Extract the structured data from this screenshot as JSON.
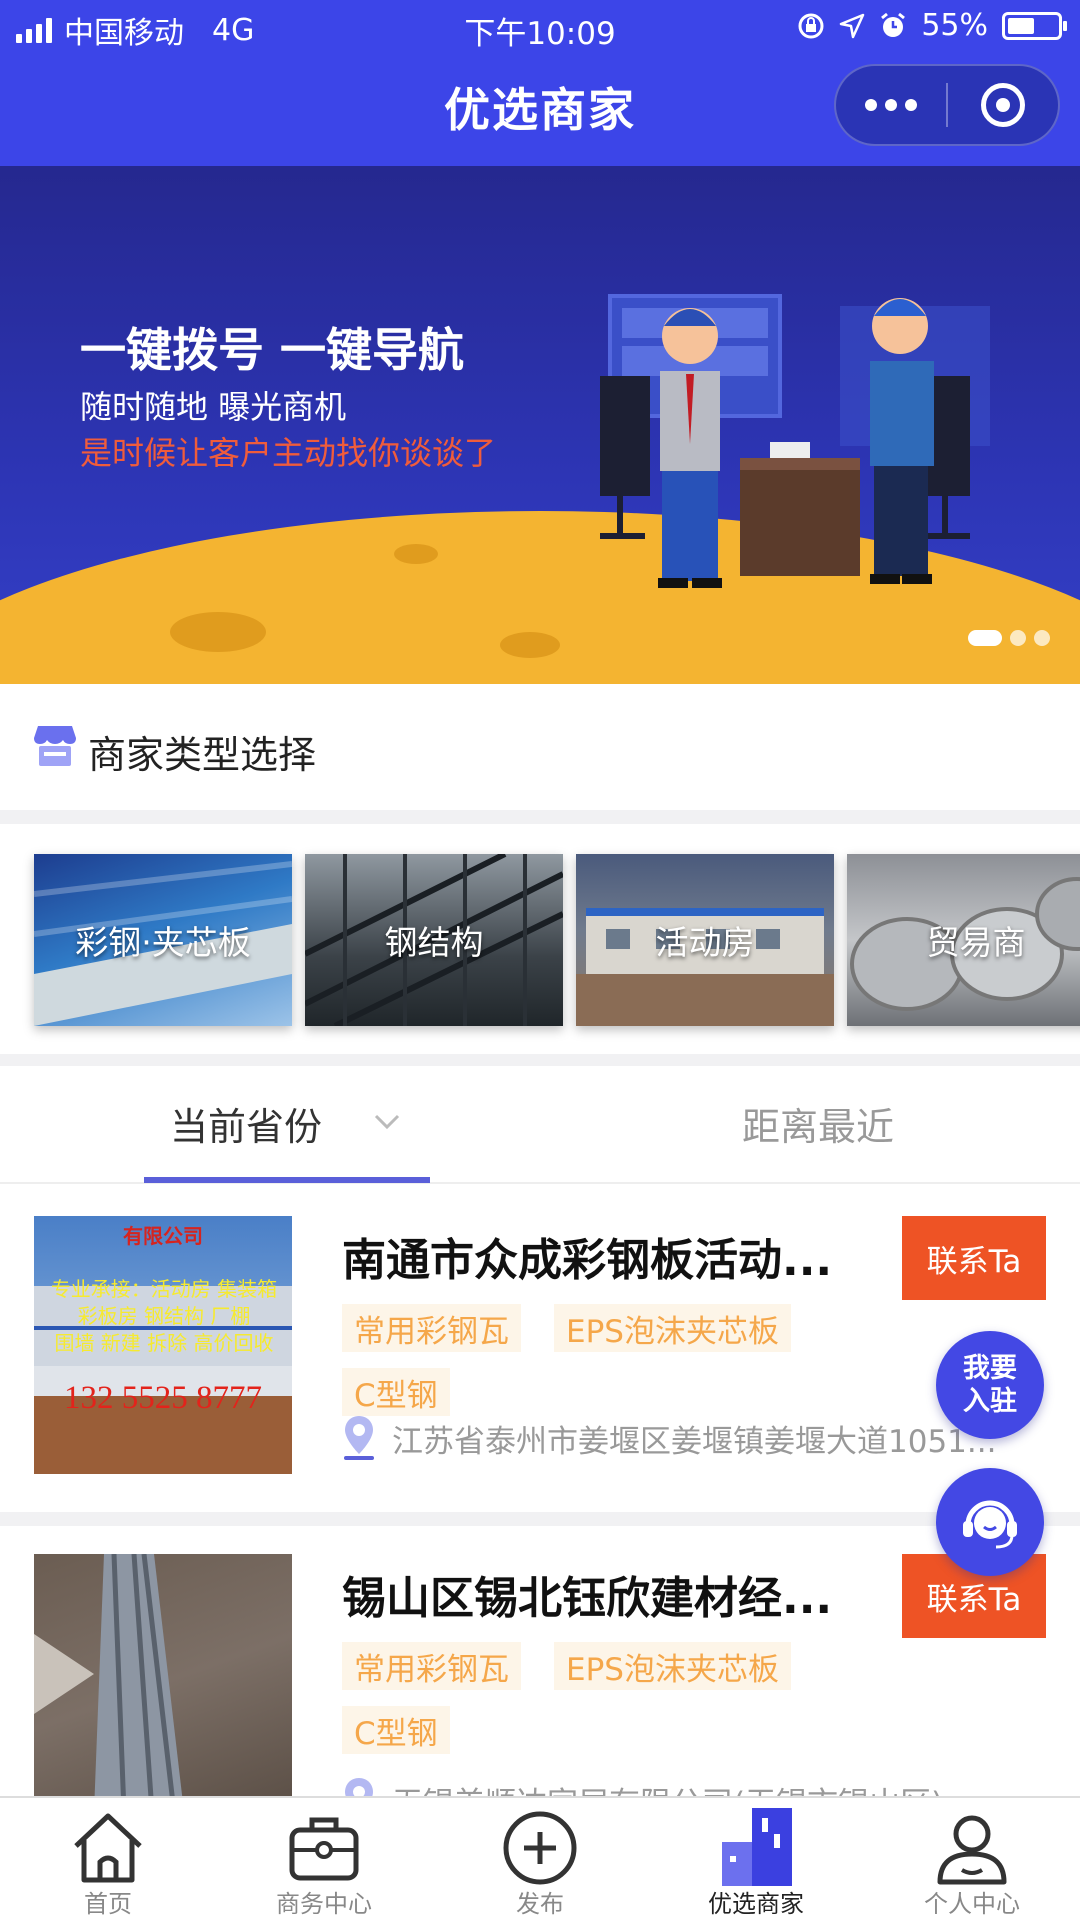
{
  "status_bar": {
    "carrier": "中国移动",
    "network": "4G",
    "time": "下午10:09",
    "battery": "55%",
    "battery_level": 0.55
  },
  "header": {
    "title": "优选商家"
  },
  "banner": {
    "headline": "一键拨号 一键导航",
    "subline": "随时随地 曝光商机",
    "slogan": "是时候让客户主动找你谈谈了",
    "slide_count": 3,
    "active_slide": 1
  },
  "section": {
    "title": "商家类型选择"
  },
  "categories": [
    {
      "label": "彩钢·夹芯板"
    },
    {
      "label": "钢结构"
    },
    {
      "label": "活动房"
    },
    {
      "label": "贸易商"
    }
  ],
  "tabs": {
    "current_province": "当前省份",
    "nearest": "距离最近"
  },
  "merchants": [
    {
      "name": "南通市众成彩钢板活动...",
      "contact_label": "联系Ta",
      "tags": [
        "常用彩钢瓦",
        "EPS泡沫夹芯板",
        "C型钢"
      ],
      "address": "江苏省泰州市姜堰区姜堰镇姜堰大道1051...",
      "thumb_text": {
        "company": "有限公司",
        "line1": "专业承接：活动房 集装箱",
        "line2": "彩板房 钢结构 厂棚",
        "line3": "围墙 新建 拆除 高价回收",
        "phone": "132 5525 8777"
      }
    },
    {
      "name": "锡山区锡北钰欣建材经...",
      "contact_label": "联系Ta",
      "tags": [
        "常用彩钢瓦",
        "EPS泡沫夹芯板",
        "C型钢"
      ],
      "address": "无锡美顺达家居有限公司(无锡市锡山区)"
    }
  ],
  "floating": {
    "join_label": "我要入驻"
  },
  "tabbar": [
    {
      "label": "首页",
      "icon": "home-icon"
    },
    {
      "label": "商务中心",
      "icon": "briefcase-icon"
    },
    {
      "label": "发布",
      "icon": "plus-circle-icon"
    },
    {
      "label": "优选商家",
      "icon": "buildings-icon"
    },
    {
      "label": "个人中心",
      "icon": "user-icon"
    }
  ],
  "colors": {
    "header_bg": "#3c45e8",
    "accent_orange": "#ee5325",
    "tag_text": "#f5a74a",
    "tab_underline": "#5a5fd9"
  }
}
